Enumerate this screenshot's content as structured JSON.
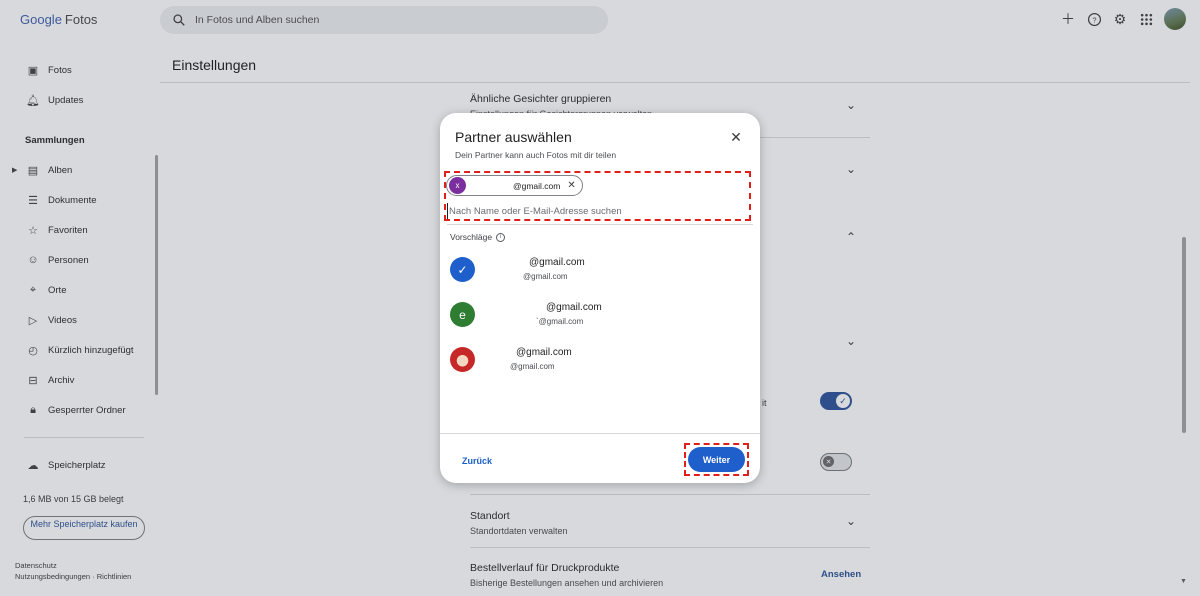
{
  "app": {
    "logo_google": "Google",
    "logo_fotos": "Fotos"
  },
  "search": {
    "placeholder": "In Fotos und Alben suchen"
  },
  "sidebar": {
    "items": [
      {
        "label": "Fotos",
        "icon": "photo-icon"
      },
      {
        "label": "Updates",
        "icon": "bell-icon"
      }
    ],
    "collections_title": "Sammlungen",
    "collections": [
      {
        "label": "Alben",
        "icon": "album-icon"
      },
      {
        "label": "Dokumente",
        "icon": "document-icon"
      },
      {
        "label": "Favoriten",
        "icon": "star-icon"
      },
      {
        "label": "Personen",
        "icon": "face-icon"
      },
      {
        "label": "Orte",
        "icon": "pin-icon"
      },
      {
        "label": "Videos",
        "icon": "play-icon"
      },
      {
        "label": "Kürzlich hinzugefügt",
        "icon": "recent-icon"
      },
      {
        "label": "Archiv",
        "icon": "archive-icon"
      },
      {
        "label": "Gesperrter Ordner",
        "icon": "lock-icon"
      }
    ],
    "storage_label": "Speicherplatz",
    "storage_used": "1,6 MB von 15 GB belegt",
    "buy_storage": "Mehr Speicherplatz kaufen",
    "footer": {
      "privacy": "Datenschutz",
      "terms": "Nutzungsbedingungen",
      "policies": "Richtlinien"
    }
  },
  "main": {
    "title": "Einstellungen",
    "rows": {
      "faces_title": "Ähnliche Gesichter gruppieren",
      "faces_sub": "Einstellungen für Gesichtergruppen verwalten",
      "partial_text": "it",
      "location_title": "Standort",
      "location_sub": "Standortdaten verwalten",
      "orders_title": "Bestellverlauf für Druckprodukte",
      "orders_sub": "Bisherige Bestellungen ansehen und archivieren",
      "orders_link": "Ansehen"
    }
  },
  "dialog": {
    "title": "Partner auswählen",
    "subtitle": "Dein Partner kann auch Fotos mit dir teilen",
    "chip": {
      "initial": "x",
      "email": "@gmail.com"
    },
    "input_placeholder": "Nach Name oder E-Mail-Adresse suchen",
    "suggestions_label": "Vorschläge",
    "suggestions": [
      {
        "name": "@gmail.com",
        "email": "@gmail.com",
        "avatar": "check",
        "avatar_color": "#1f5fcb",
        "selected": true
      },
      {
        "name": "@gmail.com",
        "email": "`@gmail.com",
        "avatar": "e",
        "avatar_color": "#2e7d32",
        "selected": false
      },
      {
        "name": "@gmail.com",
        "email": "@gmail.com",
        "avatar": "photo",
        "avatar_color": "#c62828",
        "selected": false
      }
    ],
    "back_label": "Zurück",
    "next_label": "Weiter"
  }
}
